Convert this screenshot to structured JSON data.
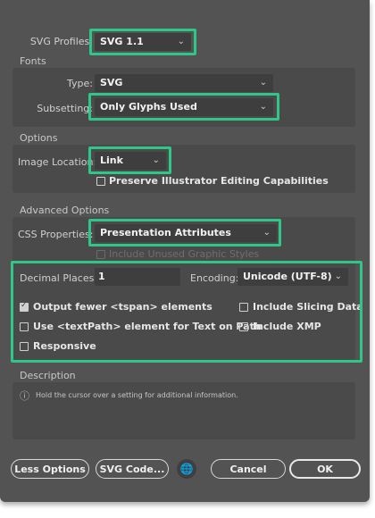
{
  "svg_profiles": {
    "label": "SVG Profiles:",
    "value": "SVG 1.1"
  },
  "fonts": {
    "title": "Fonts",
    "type_label": "Type:",
    "type_value": "SVG",
    "subsetting_label": "Subsetting:",
    "subsetting_value": "Only Glyphs Used"
  },
  "options": {
    "title": "Options",
    "image_location_label": "Image Location:",
    "image_location_value": "Link",
    "preserve_label": "Preserve Illustrator Editing Capabilities"
  },
  "advanced": {
    "title": "Advanced Options",
    "css_label": "CSS Properties:",
    "css_value": "Presentation Attributes",
    "include_unused_label": "Include Unused Graphic Styles",
    "decimal_label": "Decimal Places:",
    "decimal_value": "1",
    "encoding_label": "Encoding:",
    "encoding_value": "Unicode (UTF-8)",
    "output_fewer_label": "Output fewer <tspan> elements",
    "include_slicing_label": "Include Slicing Data",
    "textpath_label": "Use <textPath> element for Text on Path",
    "include_xmp_label": "Include XMP",
    "responsive_label": "Responsive"
  },
  "description": {
    "title": "Description",
    "text": "Hold the cursor over a setting for additional information."
  },
  "buttons": {
    "less_options": "Less Options",
    "svg_code": "SVG Code...",
    "cancel": "Cancel",
    "ok": "OK"
  },
  "icons": {
    "chevron": "chevron-down-icon",
    "info": "info-icon",
    "globe": "globe-icon",
    "check": "checkmark-icon"
  },
  "colors": {
    "highlight": "#2ec689",
    "dialog_bg": "#535353"
  }
}
